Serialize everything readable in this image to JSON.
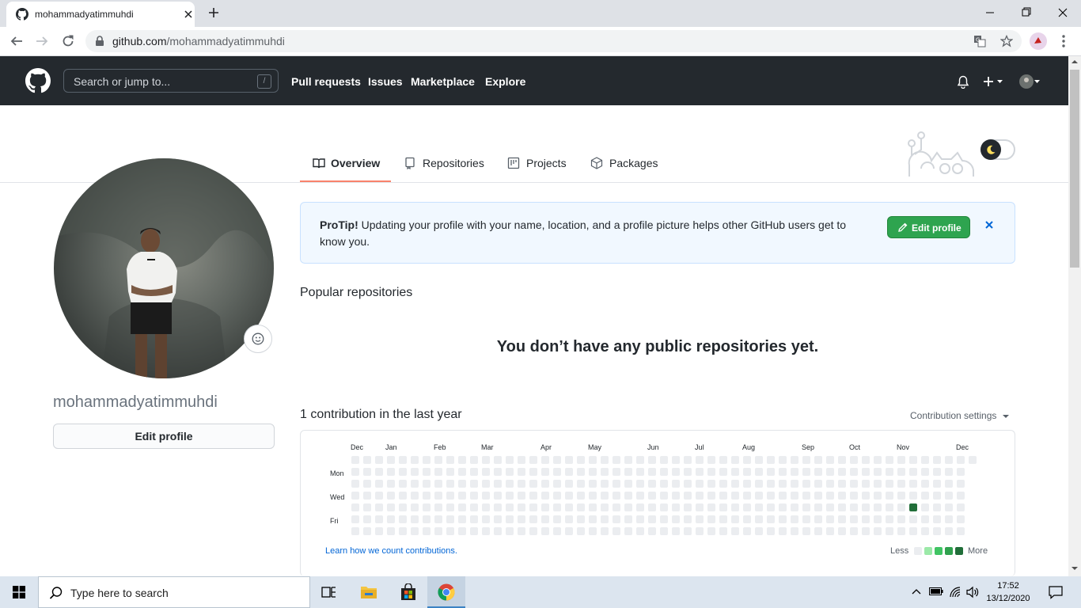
{
  "browser": {
    "tab_title": "mohammadyatimmuhdi",
    "url_host": "github.com",
    "url_path": "/mohammadyatimmuhdi"
  },
  "gh_header": {
    "search_placeholder": "Search or jump to...",
    "search_shortcut": "/",
    "nav": [
      "Pull requests",
      "Issues",
      "Marketplace",
      "Explore"
    ]
  },
  "profile_tabs": [
    "Overview",
    "Repositories",
    "Projects",
    "Packages"
  ],
  "sidebar": {
    "username": "mohammadyatimmuhdi",
    "edit_profile_label": "Edit profile"
  },
  "protip": {
    "bold": "ProTip!",
    "text": " Updating your profile with your name, location, and a profile picture helps other GitHub users get to know you.",
    "button_label": "Edit profile"
  },
  "popular_repos_heading": "Popular repositories",
  "no_repos_message": "You don’t have any public repositories yet.",
  "contributions": {
    "heading": "1 contribution in the last year",
    "settings_label": "Contribution settings",
    "months": [
      "Dec",
      "Jan",
      "Feb",
      "Mar",
      "Apr",
      "May",
      "Jun",
      "Jul",
      "Aug",
      "Sep",
      "Oct",
      "Nov",
      "Dec"
    ],
    "days": [
      "Mon",
      "Wed",
      "Fri"
    ],
    "learn_link": "Learn how we count contributions.",
    "legend_less": "Less",
    "legend_more": "More",
    "weeks": 53,
    "last_week_days": 1,
    "active_cell": {
      "week": 47,
      "day": 4,
      "level": 4
    },
    "colors": [
      "#ebedf0",
      "#9be9a8",
      "#40c463",
      "#30a14e",
      "#216e39"
    ]
  },
  "taskbar": {
    "search_placeholder": "Type here to search",
    "time": "17:52",
    "date": "13/12/2020"
  }
}
